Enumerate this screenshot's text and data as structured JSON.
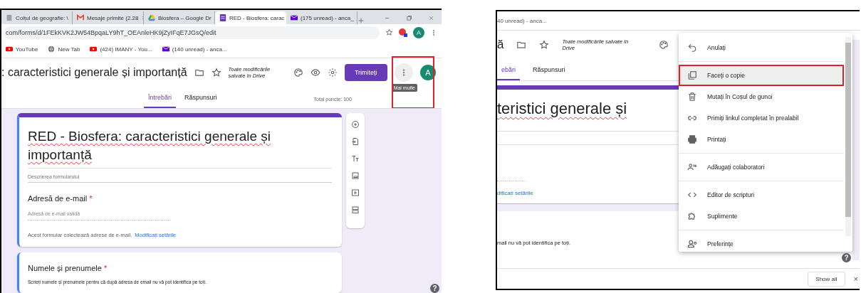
{
  "left_screenshot": {
    "browser_tabs": [
      {
        "title": "Colțul de geografie: \\",
        "selected": false,
        "kind": "page"
      },
      {
        "title": "Mesaje primite (2.28",
        "selected": false,
        "kind": "mail"
      },
      {
        "title": "Biosfera – Google Dr",
        "selected": false,
        "kind": "drive"
      },
      {
        "title": "RED - Biosfera: carac",
        "selected": true,
        "kind": "form"
      },
      {
        "title": "(175 unread) - anca_",
        "selected": false,
        "kind": "inbox"
      }
    ],
    "url": "com/forms/d/1FEkKVK2JW54BpqaLY9hT_OEAnleHK9jZyIFqE7JGsQ/edit",
    "profile_initial": "A",
    "bookmarks": [
      {
        "label": "YouTube",
        "kind": "video"
      },
      {
        "label": "New Tab",
        "kind": "globe"
      },
      {
        "label": "(424) IMANY - You...",
        "kind": "video"
      },
      {
        "label": "(140 unread) - anca...",
        "kind": "inbox"
      }
    ],
    "form_title": ": caracteristici generale și importanță",
    "save_status": "Toate modificările salvate în Drive",
    "send_button": "Trimiteți",
    "more_button": {
      "highlighted": true,
      "tooltip": "Mai multe"
    },
    "account_initial": "A",
    "form_tabs": [
      {
        "label": "Întrebări",
        "selected": true
      },
      {
        "label": "Răspunsuri",
        "selected": false
      }
    ],
    "total_points": "Total puncte: 100",
    "title_card": {
      "title": "RED - Biosfera: caracteristici generale și importanță",
      "description_placeholder": "Descrierea formularului"
    },
    "email_question": {
      "label": "Adresă de e-mail",
      "required_mark": "*",
      "placeholder": "Adresă de e-mail validă",
      "note": "Acest formular colectează adrese de e-mail.",
      "link": "Modificați setările"
    },
    "name_question": {
      "label": "Numele și prenumele",
      "required_mark": "*",
      "description": "Scrieți numele și prenumele pentru că după adresa de email nu vă pot identifica pe toți."
    },
    "help": "?"
  },
  "right_screenshot": {
    "bookmark": "40 unread) - anca...",
    "title_fragment": "ă",
    "save_status": "Toate modificările salvate în Drive",
    "form_tabs": [
      {
        "label": "ebări",
        "selected": true
      },
      {
        "label": "Răspunsuri",
        "selected": false
      }
    ],
    "form_title": "teristici generale și",
    "link": "dificați setările",
    "description": "mail nu vă pot identifica pe toți.",
    "menu": [
      {
        "label": "Anulați",
        "kind": "undo",
        "highlighted": false,
        "divider_before": false
      },
      {
        "label": "Faceți o copie",
        "kind": "copy",
        "highlighted": true,
        "divider_before": true
      },
      {
        "label": "Mutați în Coșul de gunoi",
        "kind": "trash",
        "highlighted": false,
        "divider_before": false
      },
      {
        "label": "Primiți linkul completat în prealabil",
        "kind": "link",
        "highlighted": false,
        "divider_before": false
      },
      {
        "label": "Printați",
        "kind": "print",
        "highlighted": false,
        "divider_before": false
      },
      {
        "label": "Adăugați colaboratori",
        "kind": "people",
        "highlighted": false,
        "divider_before": true
      },
      {
        "label": "Editor de scripturi",
        "kind": "code",
        "highlighted": false,
        "divider_before": true
      },
      {
        "label": "Suplimente",
        "kind": "puzzle",
        "highlighted": false,
        "divider_before": false
      },
      {
        "label": "Preferințe",
        "kind": "prefs",
        "highlighted": false,
        "divider_before": true
      }
    ],
    "help": "?",
    "show_all_button": "Show all",
    "close": "×"
  }
}
